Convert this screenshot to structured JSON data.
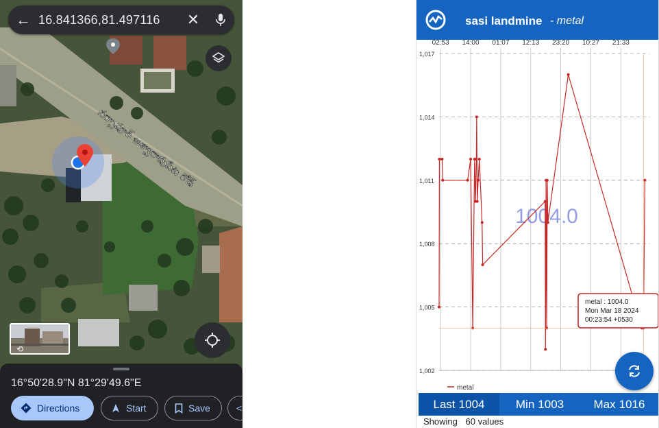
{
  "maps": {
    "search": {
      "query": "16.841366,81.497116"
    },
    "road_label": "నర్సాపూర్ అశ్వారావుపేట రోడ్",
    "coordinates": "16°50'28.9\"N 81°29'49.6\"E",
    "actions": {
      "directions": "Directions",
      "start": "Start",
      "save": "Save"
    },
    "icons": [
      "back-arrow-icon",
      "close-icon",
      "mic-icon",
      "layers-icon",
      "my-location-icon",
      "street-view-icon",
      "directions-icon",
      "navigation-icon",
      "bookmark-icon",
      "share-icon"
    ]
  },
  "sensor_app": {
    "title": "sasi landmine",
    "subtitle": "- metal",
    "accent_color": "#1565c0",
    "series_color": "#c62828",
    "big_value": "1004.0",
    "tooltip": {
      "line1": "metal : 1004.0",
      "line2": "Mon Mar 18 2024",
      "line3": "00:23:54 +0530"
    },
    "stats": {
      "last_label": "Last",
      "last_value": "1004",
      "min_label": "Min",
      "min_value": "1003",
      "max_label": "Max",
      "max_value": "1016"
    },
    "showing_label": "Showing",
    "showing_value": "60 values"
  },
  "chart_data": {
    "type": "line",
    "title": "",
    "xlabel": "",
    "ylabel": "",
    "x_tick_labels": [
      "02:53",
      "14:00",
      "01:07",
      "12:13",
      "23:20",
      "10:27",
      "21:33"
    ],
    "y_tick_labels": [
      "1,002",
      "1,005",
      "1,008",
      "1,011",
      "1,014",
      "1,017"
    ],
    "ylim": [
      1002,
      1017
    ],
    "grid": true,
    "legend_position": "bottom-left",
    "series": [
      {
        "name": "metal",
        "color": "#c62828",
        "points": [
          [
            0.0,
            1005.0
          ],
          [
            0.01,
            1012.0
          ],
          [
            0.1,
            1012.0
          ],
          [
            0.12,
            1011.0
          ],
          [
            0.95,
            1011.0
          ],
          [
            1.05,
            1012.0
          ],
          [
            1.12,
            1004.0
          ],
          [
            1.18,
            1012.0
          ],
          [
            1.21,
            1010.0
          ],
          [
            1.24,
            1012.0
          ],
          [
            1.25,
            1014.0
          ],
          [
            1.27,
            1010.0
          ],
          [
            1.3,
            1011.0
          ],
          [
            1.34,
            1012.0
          ],
          [
            1.43,
            1009.0
          ],
          [
            1.45,
            1007.0
          ],
          [
            3.53,
            1010.0
          ],
          [
            3.54,
            1003.0
          ],
          [
            3.56,
            1011.0
          ],
          [
            3.58,
            1004.0
          ],
          [
            3.6,
            1011.0
          ],
          [
            3.62,
            1009.0
          ],
          [
            4.3,
            1016.0
          ],
          [
            6.75,
            1004.0
          ],
          [
            6.8,
            1004.0
          ],
          [
            6.85,
            1011.0
          ]
        ]
      }
    ]
  }
}
